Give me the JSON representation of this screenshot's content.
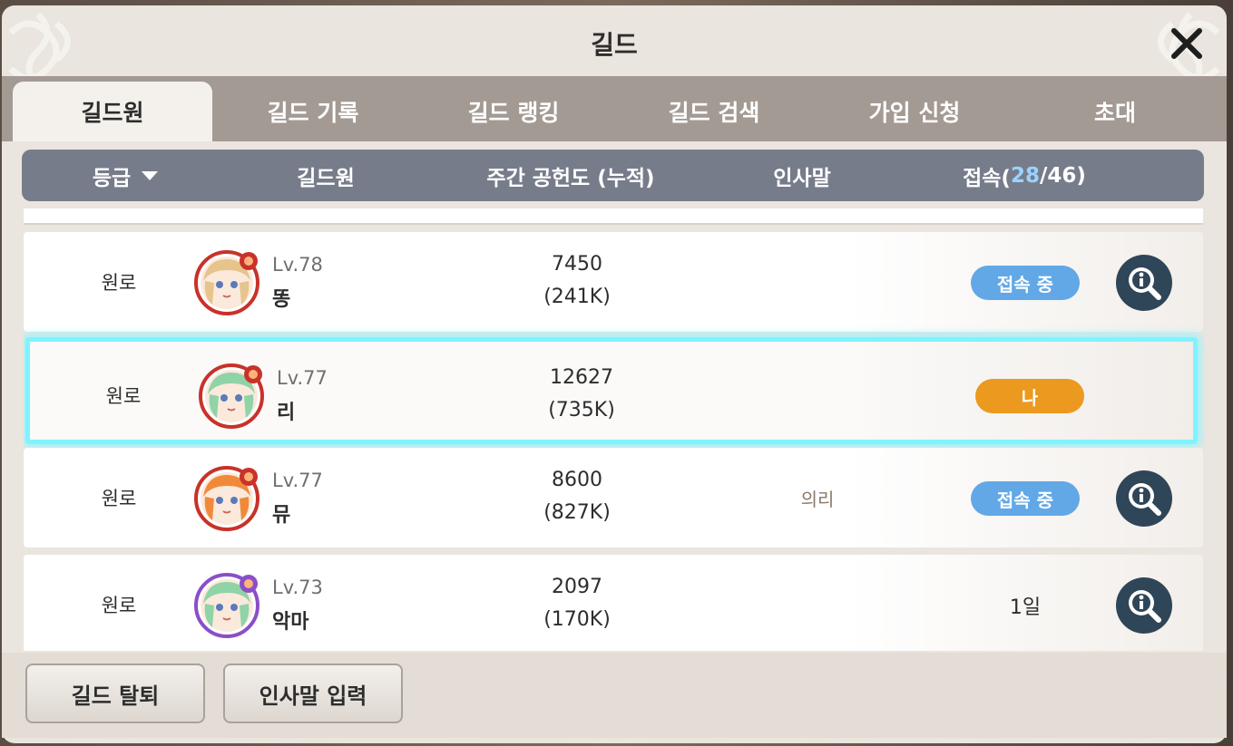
{
  "window": {
    "title": "길드"
  },
  "tabs": [
    {
      "label": "길드원",
      "active": true
    },
    {
      "label": "길드 기록",
      "active": false
    },
    {
      "label": "길드 랭킹",
      "active": false
    },
    {
      "label": "길드 검색",
      "active": false
    },
    {
      "label": "가입 신청",
      "active": false
    },
    {
      "label": "초대",
      "active": false
    }
  ],
  "header": {
    "grade": "등급",
    "member": "길드원",
    "contribution": "주간 공헌도 (누적)",
    "greeting": "인사말",
    "online_prefix": "접속(",
    "online_count": "28",
    "online_sep": "/",
    "online_total": "46",
    "online_suffix": ")"
  },
  "members": [
    {
      "grade": "원로",
      "level": "Lv.78",
      "name": "똥",
      "weekly": "7450",
      "total": "(241K)",
      "greeting": "",
      "status": "접속 중",
      "status_type": "online",
      "avatar_hair": "#e6c48c",
      "avatar_ring": "#c8322a"
    },
    {
      "grade": "원로",
      "level": "Lv.77",
      "name": "리",
      "weekly": "12627",
      "total": "(735K)",
      "greeting": "",
      "status": "나",
      "status_type": "me",
      "avatar_hair": "#8fd3a6",
      "avatar_ring": "#c8322a"
    },
    {
      "grade": "원로",
      "level": "Lv.77",
      "name": "뮤",
      "weekly": "8600",
      "total": "(827K)",
      "greeting": "의리",
      "status": "접속 중",
      "status_type": "online",
      "avatar_hair": "#f08a3a",
      "avatar_ring": "#c8322a"
    },
    {
      "grade": "원로",
      "level": "Lv.73",
      "name": "악마",
      "weekly": "2097",
      "total": "(170K)",
      "greeting": "",
      "status": "1일",
      "status_type": "text",
      "avatar_hair": "#8fd3a6",
      "avatar_ring": "#8a4fc8"
    }
  ],
  "footer": {
    "leave_label": "길드 탈퇴",
    "greeting_label": "인사말 입력"
  },
  "icons": {
    "close": "close-icon",
    "sort": "caret-down-icon",
    "inspect": "magnifier-info-icon"
  },
  "colors": {
    "online": "#62a8e6",
    "me": "#eb9a1f",
    "highlight": "#7ff3ff",
    "header_bg": "#777c8b",
    "inspect_bg": "#2f4558"
  }
}
